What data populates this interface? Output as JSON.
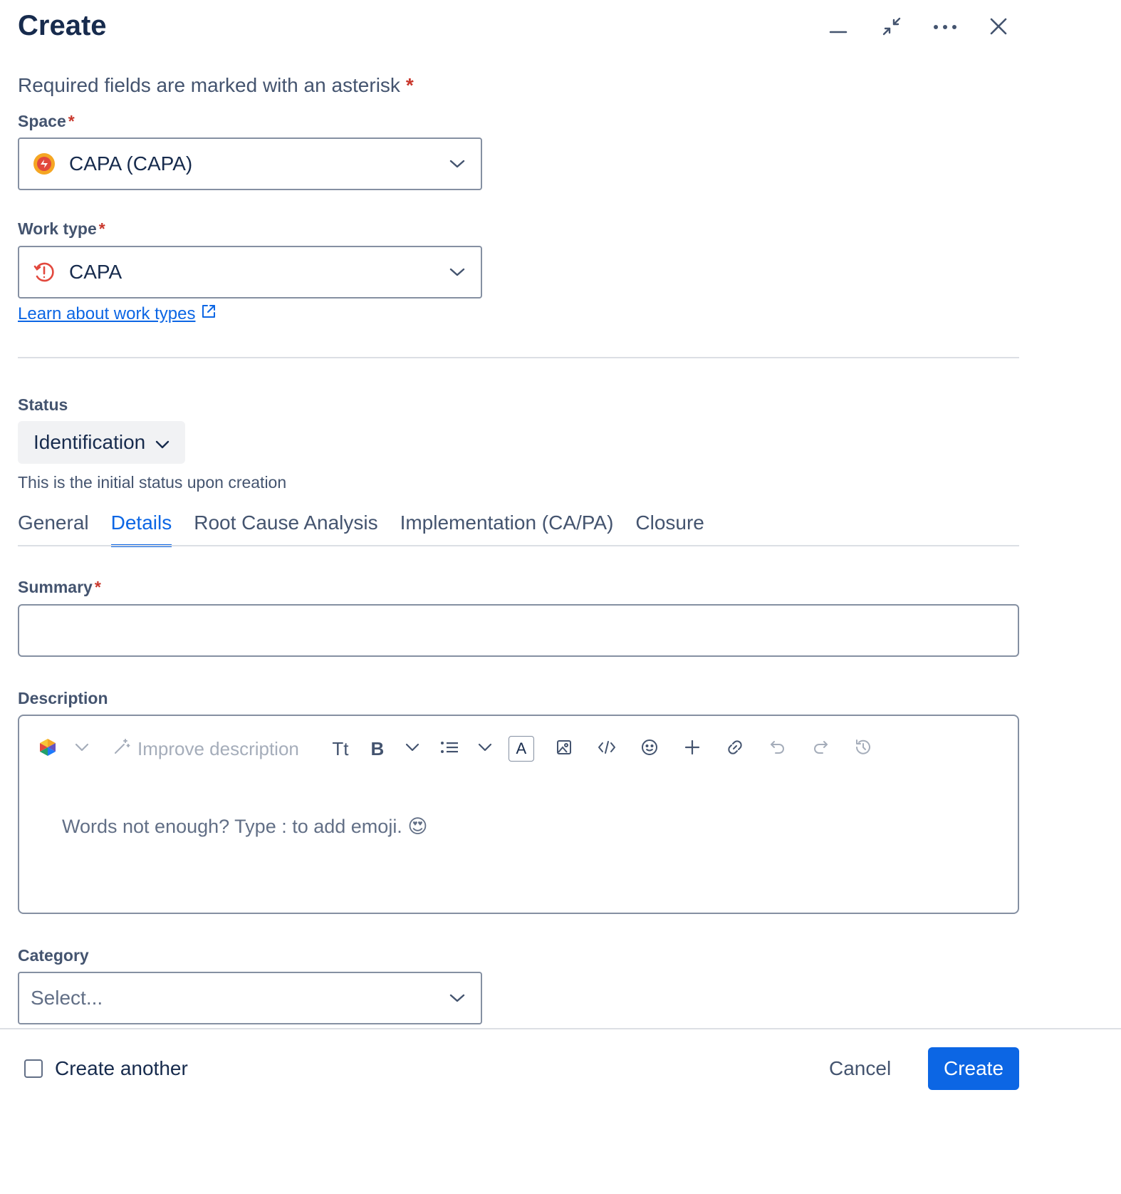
{
  "header": {
    "title": "Create",
    "icons": [
      "minimize-icon",
      "collapse-icon",
      "more-icon",
      "close-icon"
    ]
  },
  "required_note": "Required fields are marked with an asterisk",
  "asterisk": "*",
  "space": {
    "label": "Space",
    "value": "CAPA (CAPA)",
    "icon": "space-icon"
  },
  "work_type": {
    "label": "Work type",
    "value": "CAPA",
    "icon": "capa-alert-icon"
  },
  "learn_link": "Learn about work types",
  "status": {
    "label": "Status",
    "value": "Identification",
    "helper": "This is the initial status upon creation"
  },
  "tabs": [
    {
      "label": "General",
      "active": false
    },
    {
      "label": "Details",
      "active": true
    },
    {
      "label": "Root Cause Analysis",
      "active": false
    },
    {
      "label": "Implementation (CA/PA)",
      "active": false
    },
    {
      "label": "Closure",
      "active": false
    }
  ],
  "summary": {
    "label": "Summary",
    "value": ""
  },
  "description": {
    "label": "Description",
    "improve_label": "Improve description",
    "text_style_label": "Tt",
    "bold_label": "B",
    "color_label": "A",
    "placeholder": "Words not enough? Type : to add emoji. 😍"
  },
  "category": {
    "label": "Category",
    "placeholder": "Select..."
  },
  "footer": {
    "create_another": "Create another",
    "cancel": "Cancel",
    "create": "Create"
  },
  "colors": {
    "primary": "#0C66E4",
    "required": "#C9372C",
    "border": "#8590A2",
    "text": "#172B4D",
    "subtle": "#44546F"
  }
}
